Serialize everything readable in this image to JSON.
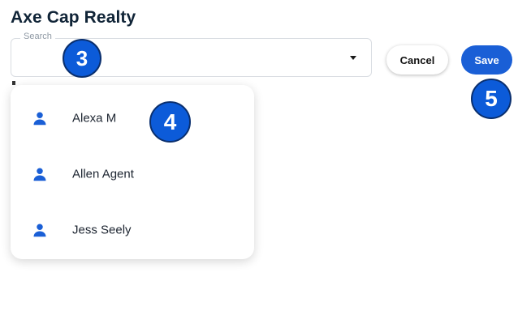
{
  "header": {
    "title": "Axe Cap Realty"
  },
  "search": {
    "label": "Search",
    "value": "",
    "placeholder": ""
  },
  "actions": {
    "cancel_label": "Cancel",
    "save_label": "Save"
  },
  "dropdown": {
    "options": [
      {
        "name": "Alexa M",
        "icon": "person-icon"
      },
      {
        "name": "Allen Agent",
        "icon": "person-icon"
      },
      {
        "name": "Jess Seely",
        "icon": "person-icon"
      }
    ]
  },
  "annotations": {
    "step_3": "3",
    "step_4": "4",
    "step_5": "5"
  },
  "colors": {
    "accent": "#1a5fd6",
    "badge": "#0c5bd9",
    "icon": "#1a5fd6"
  }
}
